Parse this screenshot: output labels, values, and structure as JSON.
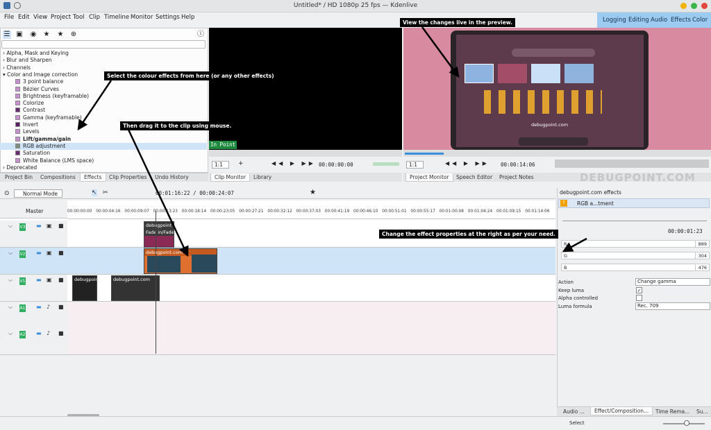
{
  "window": {
    "title": "Untitled* / HD 1080p 25 fps — Kdenlive"
  },
  "menu": [
    "File",
    "Edit",
    "View",
    "Project",
    "Tool",
    "Clip",
    "Timeline",
    "Monitor",
    "Settings",
    "Help"
  ],
  "layouts": [
    "Logging",
    "Editing",
    "Audio",
    "Effects",
    "Color"
  ],
  "effects_tree": [
    {
      "label": "Alpha, Mask and Keying",
      "type": "folder"
    },
    {
      "label": "Blur and Sharpen",
      "type": "folder"
    },
    {
      "label": "Channels",
      "type": "folder"
    },
    {
      "label": "Color and Image correction",
      "type": "folder-open"
    },
    {
      "label": "3 point balance",
      "type": "item",
      "color": "#c890d0"
    },
    {
      "label": "Bézier Curves",
      "type": "item",
      "color": "#c890d0"
    },
    {
      "label": "Brightness (keyframable)",
      "type": "item",
      "color": "#c890d0"
    },
    {
      "label": "Colorize",
      "type": "item",
      "color": "#c890d0"
    },
    {
      "label": "Contrast",
      "type": "item",
      "color": "#6a2a70"
    },
    {
      "label": "Gamma (keyframable)",
      "type": "item",
      "color": "#c890d0"
    },
    {
      "label": "Invert",
      "type": "item",
      "color": "#5a1f62"
    },
    {
      "label": "Levels",
      "type": "item",
      "color": "#c890d0"
    },
    {
      "label": "Lift/gamma/gain",
      "type": "item",
      "color": "#c890d0",
      "bold": true
    },
    {
      "label": "RGB adjustment",
      "type": "item",
      "color": "#7e8d80",
      "selected": true
    },
    {
      "label": "Saturation",
      "type": "item",
      "color": "#6a2a70"
    },
    {
      "label": "White Balance (LMS space)",
      "type": "item",
      "color": "#c890d0"
    },
    {
      "label": "Deprecated",
      "type": "folder"
    }
  ],
  "left_tabs": [
    "Project Bin",
    "Compositions",
    "Effects",
    "Clip Properties",
    "Undo History"
  ],
  "clip_monitor": {
    "in_point": "In Point",
    "zoom": "1:1",
    "timecode": "00:00:00:00",
    "tabs": [
      "Clip Monitor",
      "Library"
    ]
  },
  "project_monitor": {
    "zoom": "1:1",
    "timecode": "00:00:14:06",
    "tabs": [
      "Project Monitor",
      "Speech Editor",
      "Project Notes"
    ],
    "screen_text": "debugpoint.com"
  },
  "watermark": "DEBUGPOINT.COM",
  "timeline": {
    "mode": "Normal Mode",
    "position": "00:01:16:22 / 00:00:24:07",
    "master": "Master",
    "ruler": [
      "00:00:00:00",
      "00:00:04:16",
      "00:00:09:07",
      "00:00:13:23",
      "00:00:18:14",
      "00:00:23:05",
      "00:00:27:21",
      "00:00:32:12",
      "00:00:37:03",
      "00:00:41:19",
      "00:00:46:10",
      "00:00:51:01",
      "00:00:55:17",
      "00:01:00:08",
      "00:01:04:24",
      "00:01:09:15",
      "00:01:14:06"
    ],
    "tracks": [
      {
        "id": "V3",
        "kind": "video"
      },
      {
        "id": "V2",
        "kind": "video",
        "selected": true
      },
      {
        "id": "V1",
        "kind": "video"
      },
      {
        "id": "A1",
        "kind": "audio"
      },
      {
        "id": "A2",
        "kind": "audio"
      }
    ],
    "clips": {
      "v3_title": "debugpoint",
      "v3_sub": "Fade in/Fade out",
      "v2": "debugpoint.com",
      "v1a": "debugpoint",
      "v1b": "debugpoint.com"
    }
  },
  "effect_stack": {
    "title": "debugpoint.com effects",
    "effect_name": "RGB a...tment",
    "timecode": "00:00:01:23",
    "params": [
      {
        "name": "R",
        "value": "889"
      },
      {
        "name": "G",
        "value": "304"
      },
      {
        "name": "B",
        "value": "476"
      }
    ],
    "action_label": "Action",
    "action_value": "Change gamma",
    "keep_luma_label": "Keep luma",
    "keep_luma": "✓",
    "alpha_label": "Alpha controlled",
    "luma_label": "Luma formula",
    "luma_value": "Rec. 709"
  },
  "right_tabs": [
    "Audio ...",
    "Effect/Composition...",
    "Time Rema...",
    "Su..."
  ],
  "status": {
    "select": "Select"
  },
  "annotations": {
    "a1": "Select the colour effects from here (or any other effects)",
    "a2": "Then drag it to the clip using mouse.",
    "a3": "View the changes live in the preview.",
    "a4": "Change the effect properties at the right as per your need."
  },
  "colors": {
    "accent": "#9ccaf0",
    "selected": "#d0e4f7",
    "track_id": "#2fae62",
    "in_point": "#1d8a3e"
  }
}
